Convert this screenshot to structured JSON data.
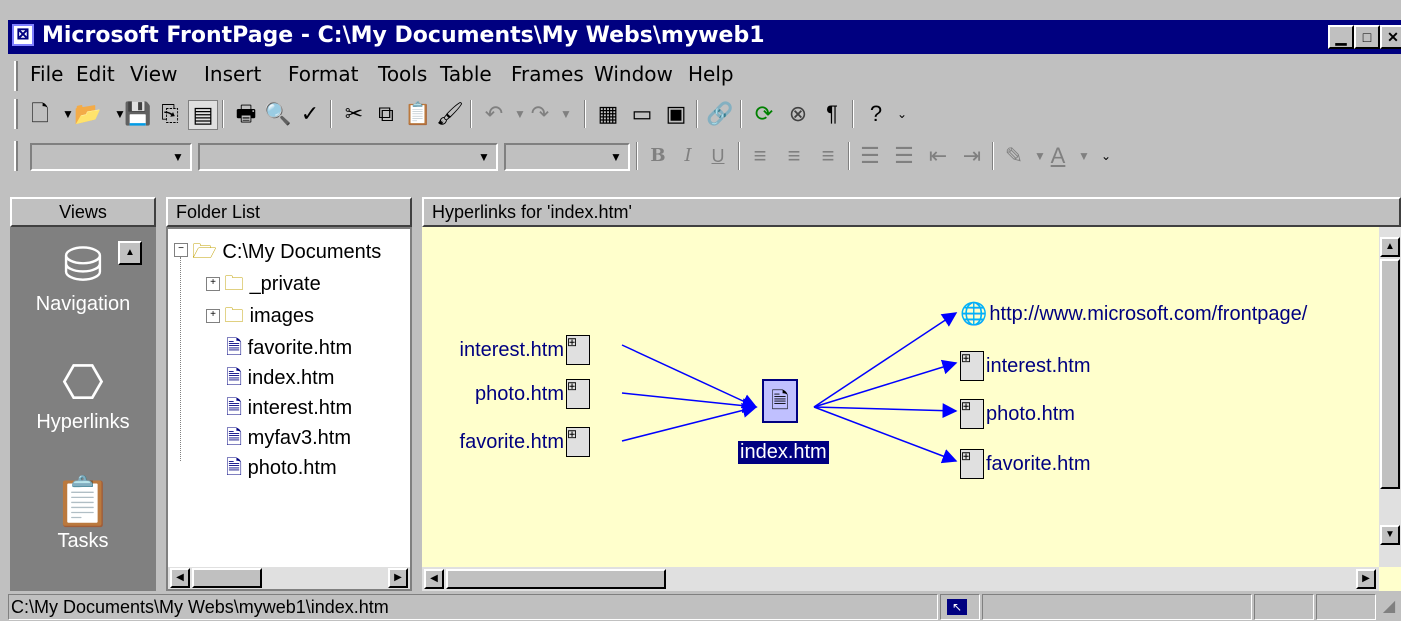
{
  "title": "Microsoft FrontPage - C:\\My Documents\\My Webs\\myweb1",
  "menu": [
    "File",
    "Edit",
    "View",
    "Insert",
    "Format",
    "Tools",
    "Table",
    "Frames",
    "Window",
    "Help"
  ],
  "views": {
    "header": "Views",
    "items": [
      {
        "label": "Navigation",
        "icon": "navigation-icon"
      },
      {
        "label": "Hyperlinks",
        "icon": "hyperlinks-icon"
      },
      {
        "label": "Tasks",
        "icon": "tasks-icon"
      }
    ]
  },
  "folder_list": {
    "header": "Folder List",
    "root": "C:\\My Documents",
    "items": [
      "_private",
      "images",
      "favorite.htm",
      "index.htm",
      "interest.htm",
      "myfav3.htm",
      "photo.htm"
    ]
  },
  "hyperlinks": {
    "header": "Hyperlinks for 'index.htm'",
    "center": "index.htm",
    "incoming": [
      "interest.htm",
      "photo.htm",
      "favorite.htm"
    ],
    "outgoing": [
      "http://www.microsoft.com/frontpage/",
      "interest.htm",
      "photo.htm",
      "favorite.htm"
    ]
  },
  "status": {
    "path": "C:\\My Documents\\My Webs\\myweb1\\index.htm"
  },
  "colors": {
    "title_bar": "#000080",
    "canvas": "#ffffcc",
    "link_arrow": "#0000ff"
  }
}
